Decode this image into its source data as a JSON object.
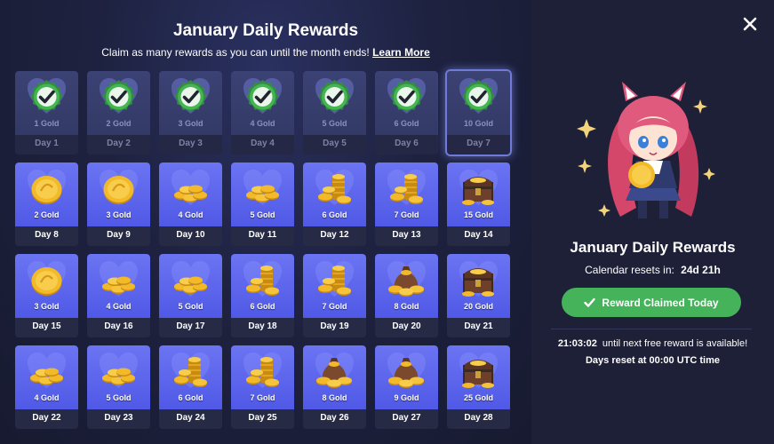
{
  "header": {
    "title": "January Daily Rewards",
    "subtitle": "Claim as many rewards as you can until the month ends!",
    "learn_more": "Learn More"
  },
  "days": [
    {
      "day": "Day 1",
      "amount": "1 Gold",
      "claimed": true,
      "art": "check-badge"
    },
    {
      "day": "Day 2",
      "amount": "2 Gold",
      "claimed": true,
      "art": "check-badge"
    },
    {
      "day": "Day 3",
      "amount": "3 Gold",
      "claimed": true,
      "art": "check-badge"
    },
    {
      "day": "Day 4",
      "amount": "4 Gold",
      "claimed": true,
      "art": "check-badge"
    },
    {
      "day": "Day 5",
      "amount": "5 Gold",
      "claimed": true,
      "art": "check-badge"
    },
    {
      "day": "Day 6",
      "amount": "6 Gold",
      "claimed": true,
      "art": "check-badge"
    },
    {
      "day": "Day 7",
      "amount": "10 Gold",
      "claimed": true,
      "current": true,
      "art": "check-badge"
    },
    {
      "day": "Day 8",
      "amount": "2 Gold",
      "art": "single-coin"
    },
    {
      "day": "Day 9",
      "amount": "3 Gold",
      "art": "single-coin"
    },
    {
      "day": "Day 10",
      "amount": "4 Gold",
      "art": "coin-pile"
    },
    {
      "day": "Day 11",
      "amount": "5 Gold",
      "art": "coin-pile"
    },
    {
      "day": "Day 12",
      "amount": "6 Gold",
      "art": "coin-stack"
    },
    {
      "day": "Day 13",
      "amount": "7 Gold",
      "art": "coin-stack"
    },
    {
      "day": "Day 14",
      "amount": "15 Gold",
      "art": "treasure-chest"
    },
    {
      "day": "Day 15",
      "amount": "3 Gold",
      "art": "single-coin"
    },
    {
      "day": "Day 16",
      "amount": "4 Gold",
      "art": "coin-pile"
    },
    {
      "day": "Day 17",
      "amount": "5 Gold",
      "art": "coin-pile"
    },
    {
      "day": "Day 18",
      "amount": "6 Gold",
      "art": "coin-stack"
    },
    {
      "day": "Day 19",
      "amount": "7 Gold",
      "art": "coin-stack"
    },
    {
      "day": "Day 20",
      "amount": "8 Gold",
      "art": "coin-bag"
    },
    {
      "day": "Day 21",
      "amount": "20 Gold",
      "art": "treasure-chest"
    },
    {
      "day": "Day 22",
      "amount": "4 Gold",
      "art": "coin-pile"
    },
    {
      "day": "Day 23",
      "amount": "5 Gold",
      "art": "coin-pile"
    },
    {
      "day": "Day 24",
      "amount": "6 Gold",
      "art": "coin-stack"
    },
    {
      "day": "Day 25",
      "amount": "7 Gold",
      "art": "coin-stack"
    },
    {
      "day": "Day 26",
      "amount": "8 Gold",
      "art": "coin-bag"
    },
    {
      "day": "Day 27",
      "amount": "9 Gold",
      "art": "coin-bag"
    },
    {
      "day": "Day 28",
      "amount": "25 Gold",
      "art": "treasure-chest"
    }
  ],
  "side": {
    "title": "January Daily Rewards",
    "reset_label": "Calendar resets in:",
    "reset_value": "24d 21h",
    "claim_button": "Reward Claimed Today",
    "timer_value": "21:03:02",
    "timer_text": "until next free reward is available!",
    "reset_note": "Days reset at 00:00 UTC time"
  },
  "colors": {
    "card_blue": "#5a63ec",
    "claimed_card": "#383f6e",
    "check_green": "#3fb34f",
    "claim_button": "#45b35a",
    "gold": "#f2b928"
  }
}
